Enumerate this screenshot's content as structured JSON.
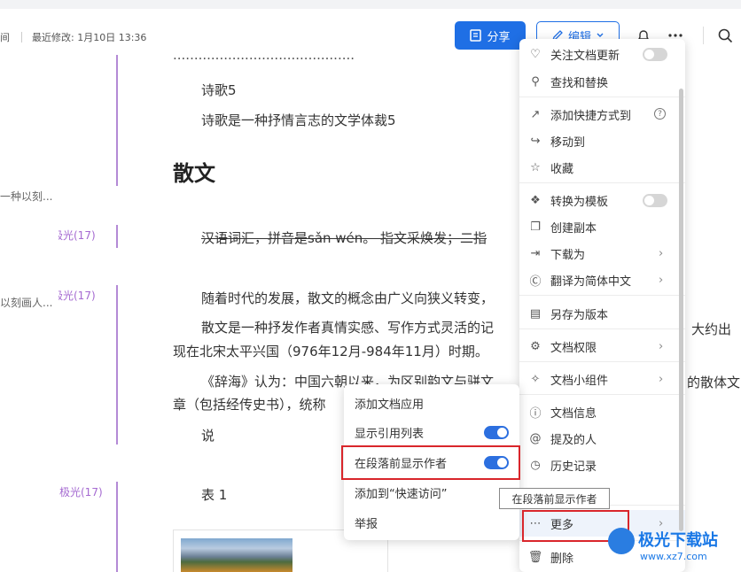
{
  "header": {
    "meta_cut": "间",
    "last_modified_label": "最近修改: 1月10日 13:36",
    "share_label": "分享",
    "edit_label": "编辑"
  },
  "comments": {
    "cut1": "一种以刻...",
    "tag1": "极光(17)",
    "tag2": "极光(17)",
    "cut2": "以刻画人...",
    "tag3": "极光(17)"
  },
  "doc": {
    "line_top": "...........................................",
    "p1": "诗歌5",
    "p2": "诗歌是一种抒情言志的文学体裁5",
    "h_prose": "散文",
    "p3": "汉语词汇，拼音是sǎn wén。   指文采焕发；二指",
    "p4": "随着时代的发展，散文的概念由广义向狭义转变，",
    "p5a": "散文是一种抒发作者真情实感、写作方式灵活的记",
    "p5b": "大约出",
    "p6": "现在北宋太平兴国（976年12月-984年11月）时期。",
    "p7a": "《辞海》认为：中国六朝以来，为区别韵文与骈文",
    "p7b": "的散体文",
    "p8a": "章（包括经传史书），统称",
    "p9": "说",
    "table_label": "表 1"
  },
  "menu": {
    "items": [
      {
        "label": "关注文档更新",
        "icon": "bell-plus-icon"
      },
      {
        "label": "查找和替换",
        "icon": "find-replace-icon"
      },
      {
        "label": "添加快捷方式到",
        "icon": "shortcut-icon"
      },
      {
        "label": "移动到",
        "icon": "move-icon"
      },
      {
        "label": "收藏",
        "icon": "star-icon"
      },
      {
        "label": "转换为模板",
        "icon": "template-icon"
      },
      {
        "label": "创建副本",
        "icon": "copy-icon"
      },
      {
        "label": "下载为",
        "icon": "download-icon"
      },
      {
        "label": "翻译为简体中文",
        "icon": "translate-icon"
      },
      {
        "label": "另存为版本",
        "icon": "version-icon"
      },
      {
        "label": "文档权限",
        "icon": "gear-icon"
      },
      {
        "label": "文档小组件",
        "icon": "widget-icon"
      },
      {
        "label": "文档信息",
        "icon": "info-icon"
      },
      {
        "label": "提及的人",
        "icon": "at-icon"
      },
      {
        "label": "历史记录",
        "icon": "history-icon"
      },
      {
        "label": "更多",
        "icon": "more-icon"
      },
      {
        "label": "删除",
        "icon": "trash-icon"
      }
    ]
  },
  "submenu": {
    "items": [
      {
        "label": "添加文档应用"
      },
      {
        "label": "显示引用列表"
      },
      {
        "label": "在段落前显示作者"
      },
      {
        "label": "添加到“快速访问”"
      },
      {
        "label": "举报"
      }
    ]
  },
  "tooltip": "在段落前显示作者",
  "watermark": {
    "title": "极光下载站",
    "url": "www.xz7.com"
  },
  "colors": {
    "accent": "#1f6fe5",
    "highlight": "#d9262b",
    "comment": "#a56ad1"
  }
}
